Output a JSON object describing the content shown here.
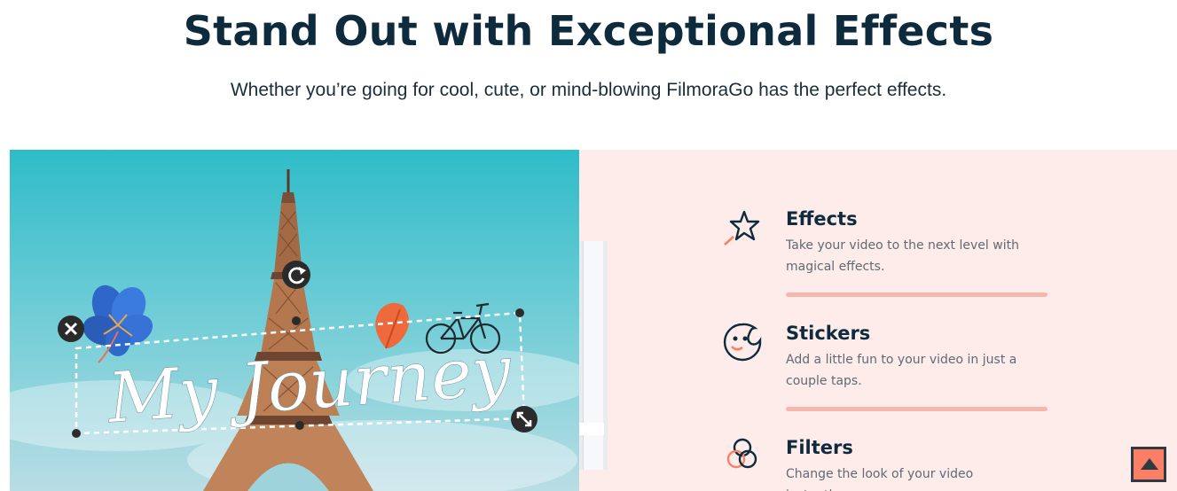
{
  "header": {
    "title": "Stand Out with Exceptional Effects",
    "subtitle": "Whether you’re going for cool, cute, or mind-blowing FilmoraGo has the perfect effects."
  },
  "hero": {
    "overlay_text": "My Journey",
    "icons": [
      "close-icon",
      "rotate-icon",
      "resize-icon",
      "flower-sticker",
      "leaf-sticker",
      "bicycle-sticker",
      "eiffel-tower"
    ]
  },
  "features": [
    {
      "icon": "star-wand-icon",
      "title": "Effects",
      "desc_line1": "Take your video to the next level with",
      "desc_line2": "magical effects."
    },
    {
      "icon": "sticker-face-icon",
      "title": "Stickers",
      "desc_line1": "Add a little fun to your video in just a",
      "desc_line2": "couple taps."
    },
    {
      "icon": "filter-circles-icon",
      "title": "Filters",
      "desc_line1": "Change the look of your video instantly.",
      "desc_line2": ""
    }
  ],
  "colors": {
    "title": "#0e2a3d",
    "panel_bg": "#fdecea",
    "separator": "#f6b8ad",
    "accent": "#fb7f65",
    "sky_top": "#2fbcc9",
    "sky_bottom": "#b9dde4"
  },
  "back_to_top": {
    "icon": "arrow-up-icon"
  }
}
